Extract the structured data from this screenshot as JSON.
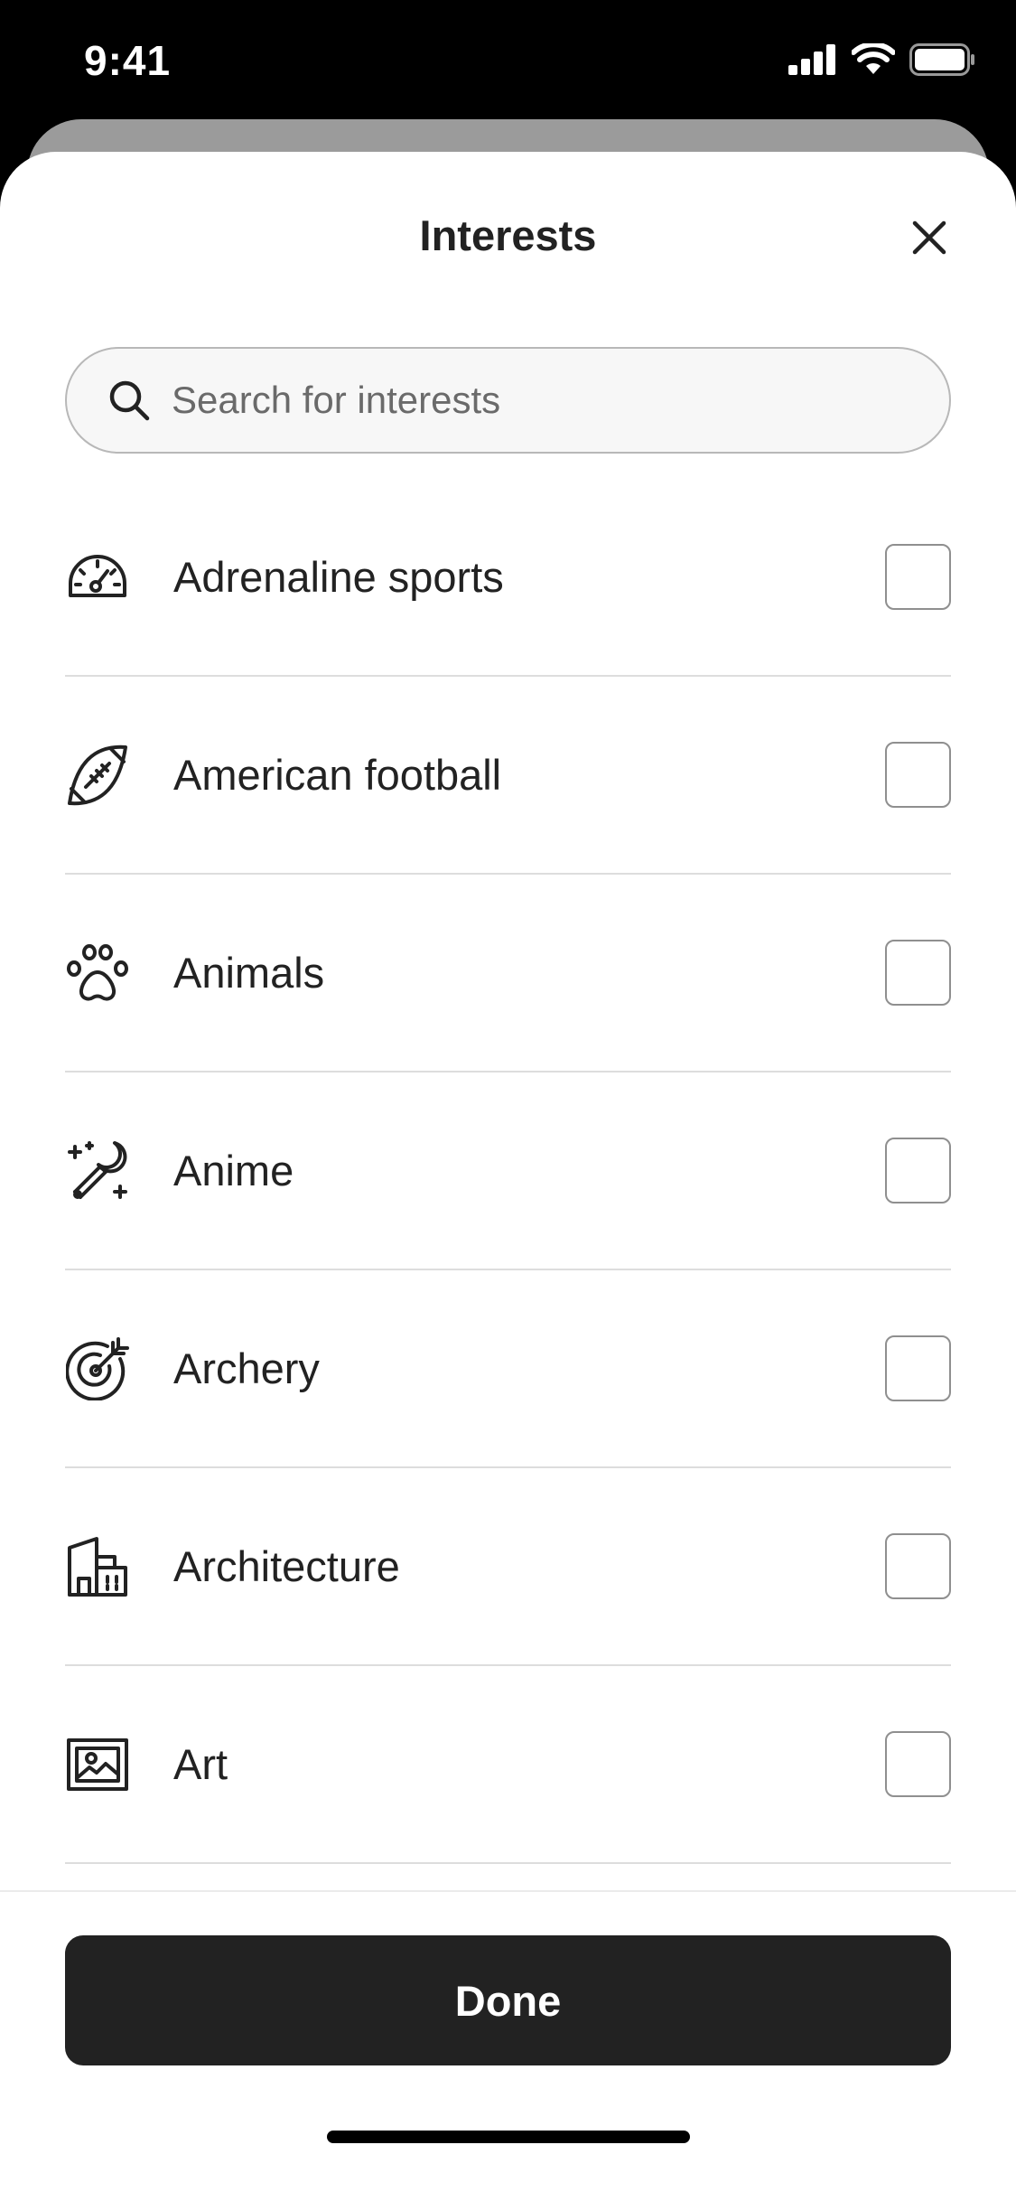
{
  "status": {
    "time": "9:41",
    "icons": [
      "cellular-signal-icon",
      "wifi-icon",
      "battery-icon"
    ]
  },
  "header": {
    "title": "Interests",
    "close_icon": "close-icon"
  },
  "search": {
    "placeholder": "Search for interests",
    "value": "",
    "icon": "search-icon"
  },
  "interests": [
    {
      "label": "Adrenaline sports",
      "icon": "speedometer-icon",
      "checked": false
    },
    {
      "label": "American football",
      "icon": "american-football-icon",
      "checked": false
    },
    {
      "label": "Animals",
      "icon": "paw-icon",
      "checked": false
    },
    {
      "label": "Anime",
      "icon": "magic-wand-icon",
      "checked": false
    },
    {
      "label": "Archery",
      "icon": "target-arrow-icon",
      "checked": false
    },
    {
      "label": "Architecture",
      "icon": "building-icon",
      "checked": false
    },
    {
      "label": "Art",
      "icon": "framed-picture-icon",
      "checked": false
    }
  ],
  "footer": {
    "done_label": "Done"
  },
  "colors": {
    "text": "#222222",
    "button_bg": "#222222",
    "divider": "#dddddd",
    "checkbox_border": "#8f8f8f",
    "search_border": "#b8b8b8",
    "search_bg": "#f7f7f7"
  }
}
